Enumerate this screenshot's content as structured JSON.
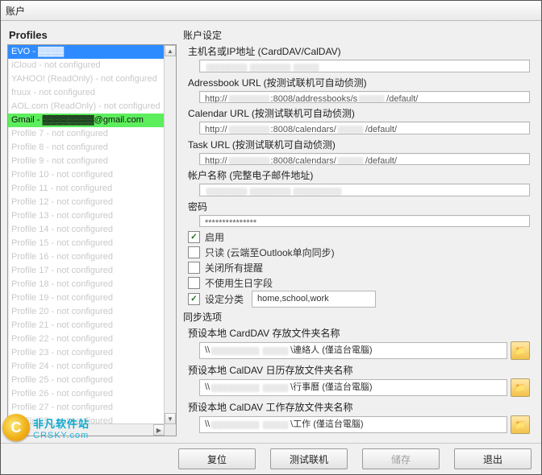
{
  "window": {
    "title": "账户"
  },
  "sidebar": {
    "header": "Profiles",
    "items": [
      {
        "label": "EVO - ▓▓▓▓",
        "state": "selected"
      },
      {
        "label": "iCloud - not configured",
        "state": "dim"
      },
      {
        "label": "YAHOO! (ReadOnly) - not configured",
        "state": "dim"
      },
      {
        "label": "fruux - not configured",
        "state": "dim"
      },
      {
        "label": "AOL.com (ReadOnly) - not configured",
        "state": "dim"
      },
      {
        "label": "Gmail - ▓▓▓▓▓▓▓▓@gmail.com",
        "state": "green"
      },
      {
        "label": "Profile 7 - not configured",
        "state": "dim"
      },
      {
        "label": "Profile 8 - not configured",
        "state": "dim"
      },
      {
        "label": "Profile 9 - not configured",
        "state": "dim"
      },
      {
        "label": "Profile 10 - not configured",
        "state": "dim"
      },
      {
        "label": "Profile 11 - not configured",
        "state": "dim"
      },
      {
        "label": "Profile 12 - not configured",
        "state": "dim"
      },
      {
        "label": "Profile 13 - not configured",
        "state": "dim"
      },
      {
        "label": "Profile 14 - not configured",
        "state": "dim"
      },
      {
        "label": "Profile 15 - not configured",
        "state": "dim"
      },
      {
        "label": "Profile 16 - not configured",
        "state": "dim"
      },
      {
        "label": "Profile 17 - not configured",
        "state": "dim"
      },
      {
        "label": "Profile 18 - not configured",
        "state": "dim"
      },
      {
        "label": "Profile 19 - not configured",
        "state": "dim"
      },
      {
        "label": "Profile 20 - not configured",
        "state": "dim"
      },
      {
        "label": "Profile 21 - not configured",
        "state": "dim"
      },
      {
        "label": "Profile 22 - not configured",
        "state": "dim"
      },
      {
        "label": "Profile 23 - not configured",
        "state": "dim"
      },
      {
        "label": "Profile 24 - not configured",
        "state": "dim"
      },
      {
        "label": "Profile 25 - not configured",
        "state": "dim"
      },
      {
        "label": "Profile 26 - not configured",
        "state": "dim"
      },
      {
        "label": "Profile 27 - not configured",
        "state": "dim"
      },
      {
        "label": "Profile 28 - not configured",
        "state": "dim"
      }
    ]
  },
  "settings": {
    "section_title": "账户设定",
    "host_label": "主机名或IP地址 (CardDAV/CalDAV)",
    "host_value": "",
    "addr_label": "Adressbook URL (按测试联机可自动侦测)",
    "addr_prefix": "http://",
    "addr_mid": ":8008/addressbooks/s",
    "addr_suffix": "/default/",
    "cal_label": "Calendar URL (按测试联机可自动侦测)",
    "cal_prefix": "http://",
    "cal_mid": ":8008/calendars/",
    "cal_suffix": "/default/",
    "task_label": "Task URL (按测试联机可自动侦测)",
    "task_prefix": "http://",
    "task_mid": ":8008/calendars/",
    "task_suffix": "/default/",
    "acct_label": "帐户名称 (完整电子邮件地址)",
    "acct_value": "",
    "pwd_label": "密码",
    "pwd_value": "***************",
    "chk_enable": "启用",
    "chk_readonly": "只读 (云端至Outlook单向同步)",
    "chk_close_reminders": "关闭所有提醒",
    "chk_no_birthday": "不使用生日字段",
    "chk_categories": "设定分类",
    "categories_value": "home,school,work"
  },
  "sync": {
    "section_title": "同步选项",
    "card_label": "预设本地 CardDAV 存放文件夹名称",
    "card_prefix": "\\\\",
    "card_mid": "\\連絡人 (僅這台電腦)",
    "cal_label": "预设本地 CalDAV 日历存放文件夹名称",
    "cal_prefix": "\\\\",
    "cal_mid": "\\行事曆 (僅這台電腦)",
    "task_label": "预设本地 CalDAV 工作存放文件夹名称",
    "task_prefix": "\\\\",
    "task_mid": "\\工作 (僅這台電腦)"
  },
  "footer": {
    "reset": "复位",
    "test": "测试联机",
    "save": "储存",
    "exit": "退出"
  },
  "logo": {
    "line1": "非凡软件站",
    "line2": "CRSKY.com"
  }
}
